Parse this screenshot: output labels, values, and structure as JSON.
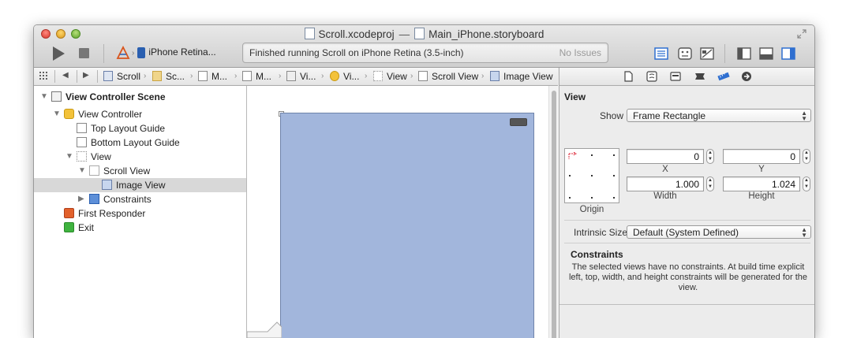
{
  "window": {
    "project_file": "Scroll.xcodeproj",
    "title_separator": "—",
    "storyboard_file": "Main_iPhone.storyboard"
  },
  "toolbar": {
    "scheme_device": "iPhone Retina...",
    "activity_status": "Finished running Scroll on iPhone Retina (3.5-inch)",
    "issues": "No Issues",
    "accent_color": "#2f6fd0"
  },
  "jumpbar": {
    "items": [
      {
        "label": "Scroll",
        "icon": "xcode-project-icon"
      },
      {
        "label": "Sc...",
        "icon": "folder-icon"
      },
      {
        "label": "M...",
        "icon": "storyboard-file-icon"
      },
      {
        "label": "M...",
        "icon": "storyboard-file-icon"
      },
      {
        "label": "Vi...",
        "icon": "scene-icon"
      },
      {
        "label": "Vi...",
        "icon": "view-controller-icon"
      },
      {
        "label": "View",
        "icon": "view-icon"
      },
      {
        "label": "Scroll View",
        "icon": "scroll-view-icon"
      },
      {
        "label": "Image View",
        "icon": "image-view-icon"
      }
    ]
  },
  "outline": {
    "items": [
      {
        "label": "View Controller Scene",
        "level": 0,
        "expanded": true
      },
      {
        "label": "View Controller",
        "level": 1,
        "expanded": true
      },
      {
        "label": "Top Layout Guide",
        "level": 2
      },
      {
        "label": "Bottom Layout Guide",
        "level": 2
      },
      {
        "label": "View",
        "level": 2,
        "expanded": true
      },
      {
        "label": "Scroll View",
        "level": 3,
        "expanded": true
      },
      {
        "label": "Image View",
        "level": 4,
        "selected": true
      },
      {
        "label": "Constraints",
        "level": 3,
        "expanded": false
      },
      {
        "label": "First Responder",
        "level": 1
      },
      {
        "label": "Exit",
        "level": 1
      }
    ]
  },
  "inspector": {
    "section_view": "View",
    "show_label": "Show",
    "show_value": "Frame Rectangle",
    "x_value": "0",
    "y_value": "0",
    "x_label": "X",
    "y_label": "Y",
    "width_value": "1.000",
    "height_value": "1.024",
    "width_label": "Width",
    "height_label": "Height",
    "origin_label": "Origin",
    "intrinsic_label": "Intrinsic Size",
    "intrinsic_value": "Default (System Defined)",
    "constraints_title": "Constraints",
    "constraints_note": "The selected views have no constraints. At build time explicit left, top, width, and height constraints will be generated for the view."
  },
  "canvas": {
    "view_color": "#a2b6dc"
  }
}
